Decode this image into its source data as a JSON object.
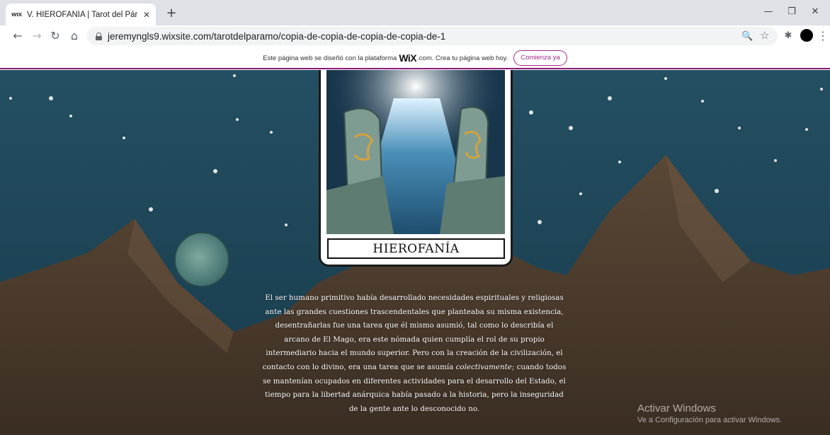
{
  "browser": {
    "tab": {
      "favicon_text": "WIX",
      "title": "V. HIEROFANÍA | Tarot del Páram",
      "close_glyph": "✕"
    },
    "new_tab_glyph": "+",
    "window_controls": {
      "minimize": "—",
      "restore": "❐",
      "close": "✕"
    },
    "nav": {
      "back": "←",
      "forward": "→",
      "reload": "↻",
      "home": "⌂"
    },
    "url": "jeremyngls9.wixsite.com/tarotdelparamo/copia-de-copia-de-copia-de-copia-de-1",
    "omnibox_icons": {
      "zoom": "🔍",
      "bookmark": "☆"
    },
    "toolbar_icons": {
      "extensions": "✱",
      "menu": "⋮"
    }
  },
  "wix_banner": {
    "text_before": "Este página web se diseñó con la plataforma",
    "logo": "WiX",
    "text_after": ".com. Crea tu página web hoy.",
    "cta": "Comienza ya",
    "accent_color": "#a32b8a"
  },
  "card": {
    "title": "HIEROFANÍA"
  },
  "body": {
    "text_1": "El ser humano primitivo había desarrollado necesidades espirituales y religiosas ante las grandes cuestiones trascendentales que planteaba su misma existencia, desentrañarlas fue una tarea que él mismo asumió, tal como lo describía el arcano de El Mago, era este nómada quien cumplía el rol de su propio intermediario hacia el mundo superior. Pero con la creación de la civilización, el contacto con lo divino, era una tarea que se asumía",
    "text_italic": "colectivamente",
    "text_2": "; cuando todos se mantenían ocupados en diferentes actividades para el desarrollo del Estado, el tiempo para la libertad anárquica había pasado a la historia, pero la inseguridad de la gente ante lo desconocido no."
  },
  "watermark": {
    "title": "Activar Windows",
    "subtitle": "Ve a Configuración para activar Windows."
  },
  "colors": {
    "sky": "#1e4858",
    "mountain": "#4a3a2c",
    "tabstrip": "#dee1e6"
  }
}
